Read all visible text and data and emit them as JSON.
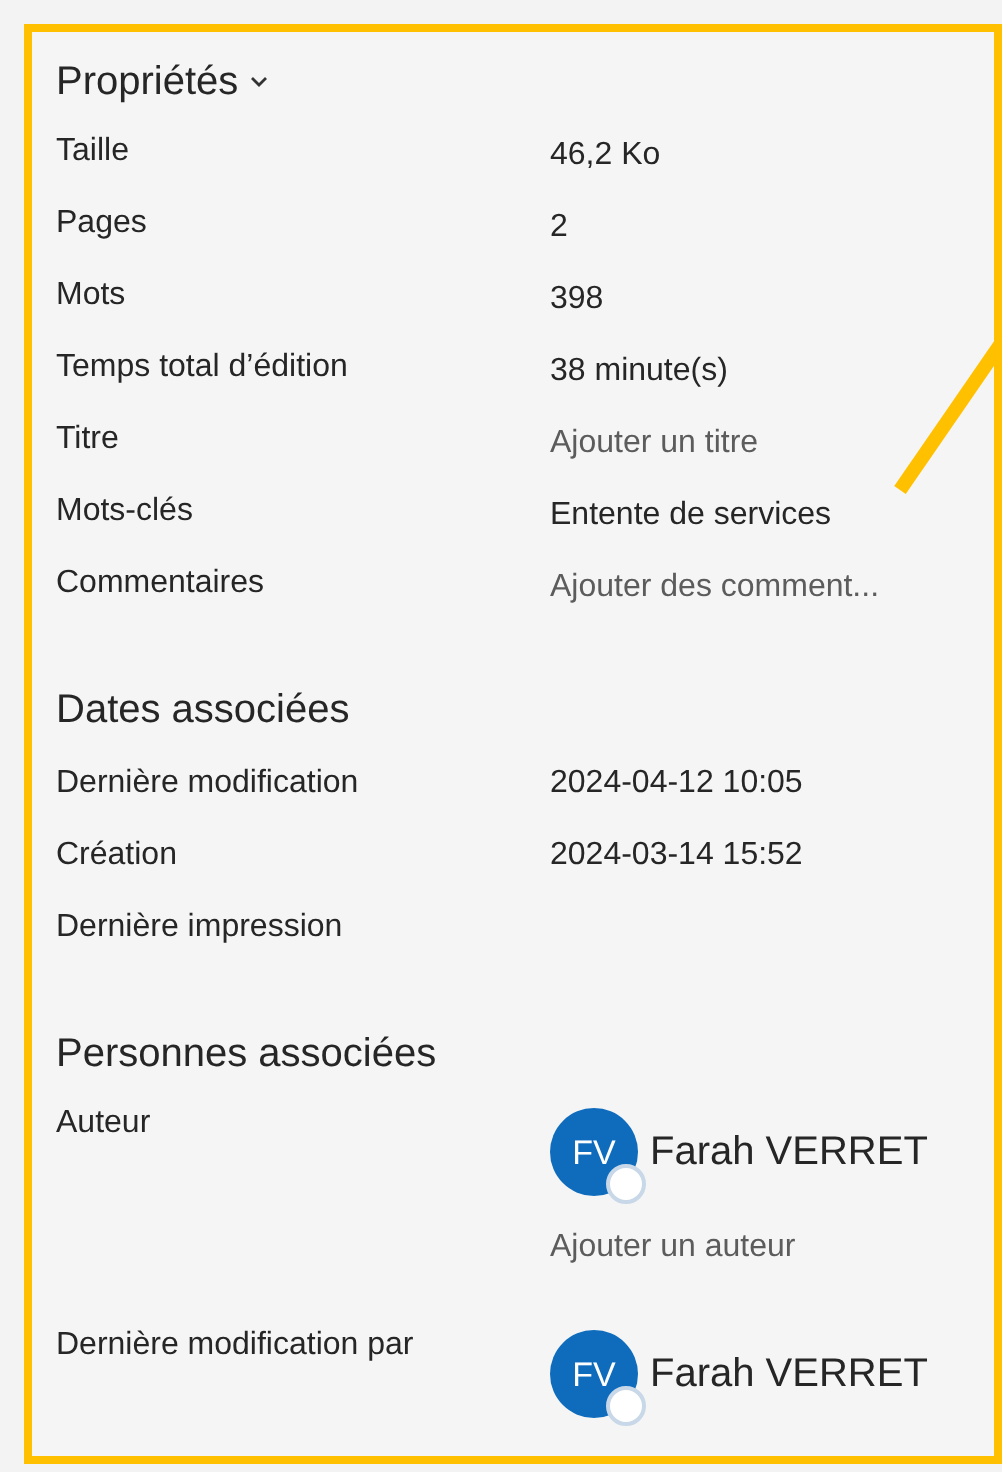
{
  "properties": {
    "title": "Propriétés",
    "rows": [
      {
        "label": "Taille",
        "value": "46,2 Ko",
        "kind": "value"
      },
      {
        "label": "Pages",
        "value": "2",
        "kind": "value"
      },
      {
        "label": "Mots",
        "value": "398",
        "kind": "value"
      },
      {
        "label": "Temps total d’édition",
        "value": "38 minute(s)",
        "kind": "value"
      },
      {
        "label": "Titre",
        "value": "Ajouter un titre",
        "kind": "placeholder"
      },
      {
        "label": "Mots-clés",
        "value": "Entente de services",
        "kind": "value"
      },
      {
        "label": "Commentaires",
        "value": "Ajouter des comment...",
        "kind": "placeholder"
      }
    ]
  },
  "dates": {
    "title": "Dates associées",
    "rows": [
      {
        "label": "Dernière modification",
        "value": "2024-04-12 10:05"
      },
      {
        "label": "Création",
        "value": "2024-03-14 15:52"
      },
      {
        "label": "Dernière impression"
      }
    ]
  },
  "people": {
    "title": "Personnes associées",
    "rows": [
      {
        "label": "Auteur",
        "person": {
          "initials": "FV",
          "name": "Farah VERRET"
        },
        "add_link": "Ajouter un auteur"
      },
      {
        "label": "Dernière modification par",
        "person": {
          "initials": "FV",
          "name": "Farah VERRET"
        }
      }
    ]
  }
}
